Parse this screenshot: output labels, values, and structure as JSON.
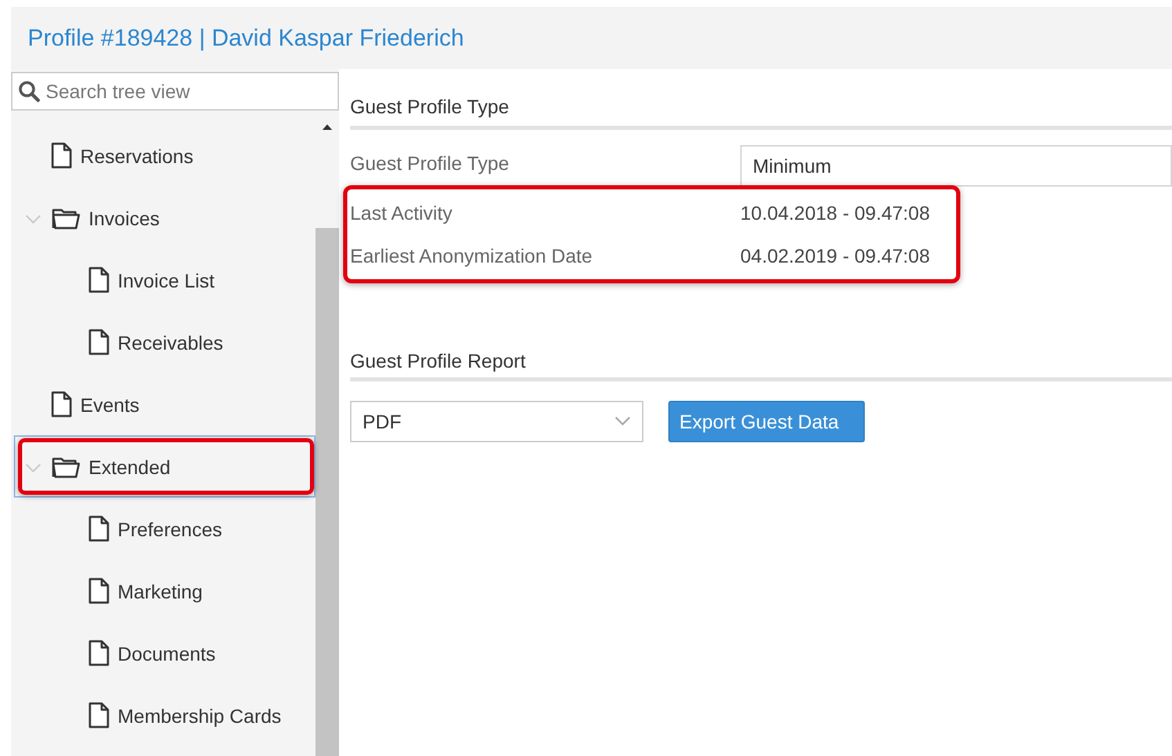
{
  "header": {
    "title": "Profile #189428 | David Kaspar Friederich"
  },
  "sidebar": {
    "search": {
      "placeholder": "Search tree view"
    },
    "tree": [
      {
        "label": "Reservations",
        "kind": "page",
        "selected": false,
        "highlighted": false
      },
      {
        "label": "Invoices",
        "kind": "folder",
        "expanded": true,
        "selected": false,
        "highlighted": false,
        "children": [
          {
            "label": "Invoice List",
            "kind": "page",
            "selected": false,
            "highlighted": false
          },
          {
            "label": "Receivables",
            "kind": "page",
            "selected": false,
            "highlighted": false
          }
        ]
      },
      {
        "label": "Events",
        "kind": "page",
        "selected": false,
        "highlighted": false
      },
      {
        "label": "Extended",
        "kind": "folder",
        "expanded": true,
        "selected": true,
        "highlighted": true,
        "children": [
          {
            "label": "Preferences",
            "kind": "page",
            "selected": false,
            "highlighted": false
          },
          {
            "label": "Marketing",
            "kind": "page",
            "selected": false,
            "highlighted": false
          },
          {
            "label": "Documents",
            "kind": "page",
            "selected": false,
            "highlighted": false
          },
          {
            "label": "Membership Cards",
            "kind": "page",
            "selected": false,
            "highlighted": false
          }
        ]
      }
    ]
  },
  "type_section": {
    "title": "Guest Profile Type",
    "type_field": {
      "label": "Guest Profile Type",
      "value": "Minimum"
    },
    "info": {
      "highlighted": true,
      "rows": [
        {
          "label": "Last Activity",
          "value": "10.04.2018 - 09.47:08"
        },
        {
          "label": "Earliest Anonymization Date",
          "value": "04.02.2019 - 09.47:08"
        }
      ]
    }
  },
  "report_section": {
    "title": "Guest Profile Report",
    "format": {
      "value": "PDF"
    },
    "button": "Export Guest Data"
  }
}
